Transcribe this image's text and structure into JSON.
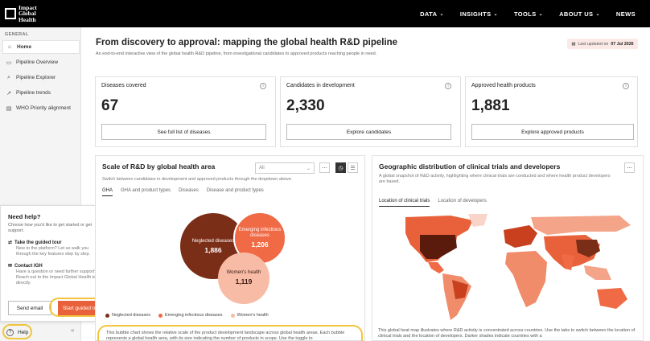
{
  "brand": {
    "line1": "Impact",
    "line2": "Global",
    "line3": "Health"
  },
  "nav": [
    {
      "label": "DATA",
      "dropdown": true
    },
    {
      "label": "INSIGHTS",
      "dropdown": true
    },
    {
      "label": "TOOLS",
      "dropdown": true
    },
    {
      "label": "ABOUT US",
      "dropdown": true
    },
    {
      "label": "NEWS",
      "dropdown": false
    }
  ],
  "sidebar": {
    "heading": "GENERAL",
    "items": [
      {
        "label": "Home",
        "icon": "home-icon",
        "active": true
      },
      {
        "label": "Pipeline Overview",
        "icon": "overview-icon"
      },
      {
        "label": "Pipeline Explorer",
        "icon": "search-icon"
      },
      {
        "label": "Pipeline trends",
        "icon": "trends-icon"
      },
      {
        "label": "WHO Priority alignment",
        "icon": "clipboard-icon"
      }
    ],
    "help_label": "Help"
  },
  "help_panel": {
    "title": "Need help?",
    "subtitle": "Choose how you'd like to get started or get support.",
    "options": [
      {
        "title": "Take the guided tour",
        "desc": "New to the platform? Let us walk you through the key features step by step."
      },
      {
        "title": "Contact IGH",
        "desc": "Have a question or need further support? Reach out to the Impact Global Health team directly."
      }
    ],
    "email_button": "Send email",
    "tour_button": "Start guided tour"
  },
  "page": {
    "title": "From discovery to approval: mapping the global health R&D pipeline",
    "subtitle": "An end-to-end interactive view of the global health R&D pipeline, from investigational candidates to approved products reaching people in need.",
    "updated_prefix": "Last updated on",
    "updated_date": "07 Jul 2026"
  },
  "stats": [
    {
      "label": "Diseases covered",
      "value": "67",
      "button": "See full list of diseases"
    },
    {
      "label": "Candidates in development",
      "value": "2,330",
      "button": "Explore candidates"
    },
    {
      "label": "Approved health products",
      "value": "1,881",
      "button": "Explore approved products"
    }
  ],
  "scale": {
    "title": "Scale of R&D by global health area",
    "subtitle": "Switch between candidates in development and approved products through the dropdown above.",
    "select_value": "All",
    "tabs": [
      "GHA",
      "GHA and product types",
      "Diseases",
      "Disease and product types"
    ],
    "description": "This bubble chart shows the relative scale of the product development landscape across global health areas. Each bubble represents a global health area, with its size indicating the number of products in scope. Use the toggle to"
  },
  "chart_data": {
    "type": "bubble",
    "categories": [
      "Neglected diseases",
      "Emerging infectious diseases",
      "Women's health"
    ],
    "values": [
      1886,
      1206,
      1119
    ],
    "labels": [
      "1,886",
      "1,206",
      "1,119"
    ],
    "colors": [
      "#7a2e17",
      "#ef6a45",
      "#f8bca6"
    ],
    "legend": [
      "Neglected diseases",
      "Emerging infectious diseases",
      "Women's health"
    ]
  },
  "geo": {
    "title": "Geographic distribution of clinical trials and developers",
    "subtitle": "A global snapshot of R&D activity, highlighting where clinical trials are conducted and where health product developers are based.",
    "tabs": [
      "Location of clinical trials",
      "Location of developers"
    ],
    "description": "This global heat map illustrates where R&D activity is concentrated across countries. Use the tabs to switch between the location of clinical trials and the location of developers. Darker shades indicate countries with a"
  }
}
